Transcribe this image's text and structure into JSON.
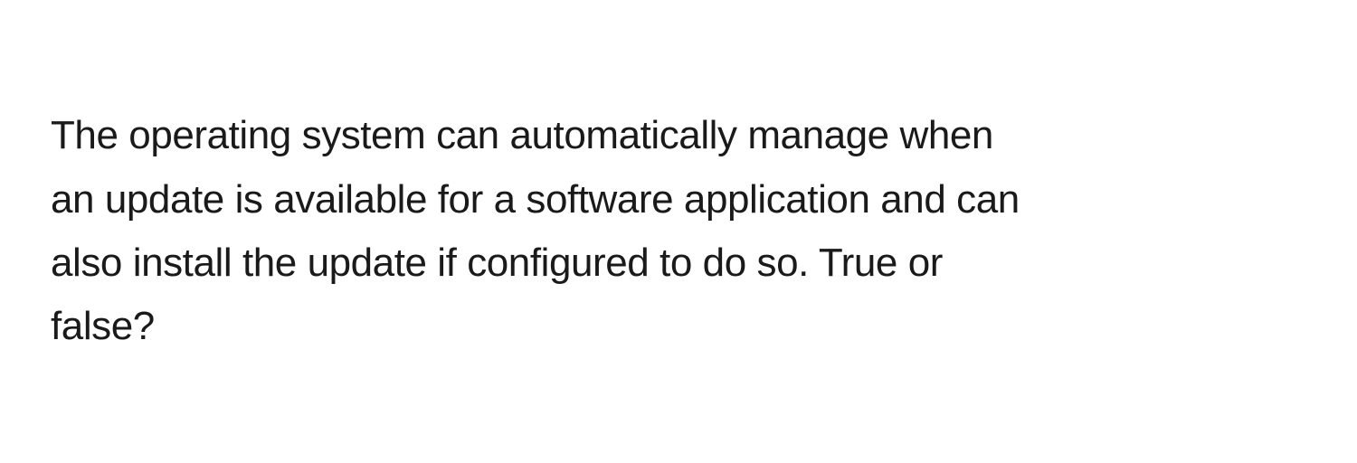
{
  "question": {
    "text": "The operating system can automatically manage when an update is available for a software application and can also install the update if configured to do so. True or false?"
  }
}
